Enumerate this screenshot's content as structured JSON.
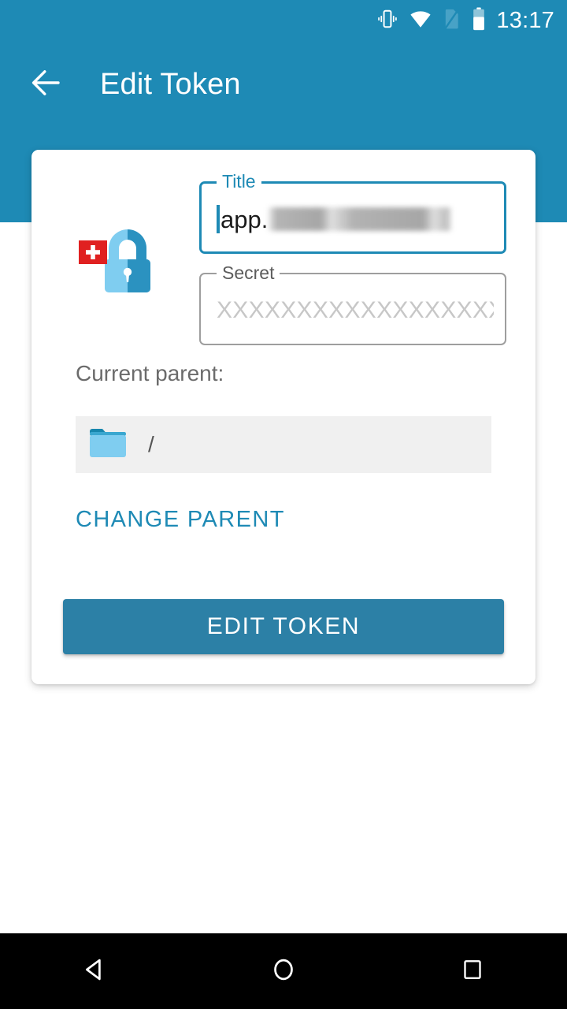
{
  "status_bar": {
    "time": "13:17",
    "icons": [
      {
        "name": "vibrate-icon"
      },
      {
        "name": "wifi-icon"
      },
      {
        "name": "sim-card-missing-icon"
      },
      {
        "name": "battery-icon"
      }
    ]
  },
  "app_bar": {
    "back_icon": "arrow-left-icon",
    "title": "Edit Token"
  },
  "card": {
    "logo": {
      "name": "swiss-padlock-logo",
      "colors": {
        "cross_badge": "#e02020",
        "padlock_light": "#7fcdf0",
        "padlock_dark": "#2b92c0"
      }
    },
    "fields": [
      {
        "name": "title-field",
        "label": "Title",
        "value": "app.",
        "redacted": true,
        "focused": true,
        "placeholder": ""
      },
      {
        "name": "secret-field",
        "label": "Secret",
        "value": "",
        "redacted": false,
        "focused": false,
        "placeholder": "XXXXXXXXXXXXXXXXXXX"
      }
    ],
    "parent": {
      "label": "Current parent:",
      "folder_icon": "folder-icon",
      "path": "/"
    },
    "change_parent_label": "CHANGE PARENT",
    "submit_label": "EDIT TOKEN"
  },
  "nav_bar": {
    "back_label": "back-triangle-icon",
    "home_label": "home-circle-icon",
    "recents_label": "recents-square-icon"
  },
  "colors": {
    "header_teal": "#1e8ab5",
    "accent": "#1e8ab5",
    "button": "#2c80a6",
    "field_border": "#9e9e9e",
    "parent_row_bg": "#f0f0f0"
  }
}
